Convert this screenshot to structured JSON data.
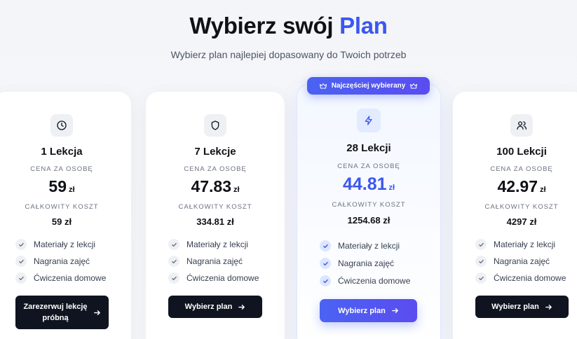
{
  "header": {
    "title_main": "Wybierz swój",
    "title_accent": "Plan",
    "subtitle": "Wybierz plan najlepiej dopasowany do Twoich potrzeb"
  },
  "badge": {
    "label": "Najczęściej wybierany",
    "icon": "crown-icon"
  },
  "labels": {
    "price_per_person": "CENA ZA OSOBĘ",
    "total_cost": "CAŁKOWITY KOSZT"
  },
  "plans": [
    {
      "name": "1 Lekcja",
      "icon": "clock-icon",
      "price": "59",
      "currency": "zł",
      "total": "59 zł",
      "features": [
        "Materiały z lekcji",
        "Nagrania zajęć",
        "Ćwiczenia domowe"
      ],
      "button_line1": "Zarezerwuj lekcję",
      "button_line2": "próbną"
    },
    {
      "name": "7 Lekcje",
      "icon": "shield-icon",
      "price": "47.83",
      "currency": "zł",
      "total": "334.81 zł",
      "features": [
        "Materiały z lekcji",
        "Nagrania zajęć",
        "Ćwiczenia domowe"
      ],
      "button": "Wybierz plan"
    },
    {
      "name": "28 Lekcji",
      "icon": "lightning-icon",
      "price": "44.81",
      "currency": "zł",
      "total": "1254.68 zł",
      "features": [
        "Materiały z lekcji",
        "Nagrania zajęć",
        "Ćwiczenia domowe"
      ],
      "button": "Wybierz plan",
      "featured": true
    },
    {
      "name": "100 Lekcji",
      "icon": "users-icon",
      "price": "42.97",
      "currency": "zł",
      "total": "4297 zł",
      "features": [
        "Materiały z lekcji",
        "Nagrania zajęć",
        "Ćwiczenia domowe"
      ],
      "button": "Wybierz plan"
    }
  ],
  "colors": {
    "accent": "#3b57f0",
    "dark_button": "#0f1420",
    "text": "#0f1115"
  }
}
